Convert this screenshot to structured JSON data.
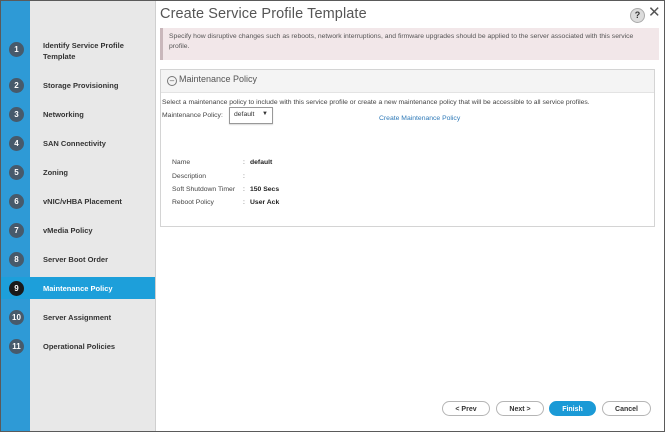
{
  "title": "Create Service Profile Template",
  "banner_text": "Specify how disruptive changes such as reboots, network interruptions, and firmware upgrades should be applied to the server associated with this service profile.",
  "steps": [
    {
      "num": "1",
      "label": "Identify Service Profile Template"
    },
    {
      "num": "2",
      "label": "Storage Provisioning"
    },
    {
      "num": "3",
      "label": "Networking"
    },
    {
      "num": "4",
      "label": "SAN Connectivity"
    },
    {
      "num": "5",
      "label": "Zoning"
    },
    {
      "num": "6",
      "label": "vNIC/vHBA Placement"
    },
    {
      "num": "7",
      "label": "vMedia Policy"
    },
    {
      "num": "8",
      "label": "Server Boot Order"
    },
    {
      "num": "9",
      "label": "Maintenance Policy"
    },
    {
      "num": "10",
      "label": "Server Assignment"
    },
    {
      "num": "11",
      "label": "Operational Policies"
    }
  ],
  "active_step": "9",
  "panel": {
    "title": "Maintenance Policy",
    "description": "Select a maintenance policy to include with this service profile or create a new maintenance policy that will be accessible to all service profiles.",
    "select_label": "Maintenance Policy:",
    "select_value": "default",
    "create_link": "Create Maintenance Policy",
    "details": [
      {
        "key": "Name",
        "value": "default"
      },
      {
        "key": "Description",
        "value": ""
      },
      {
        "key": "Soft Shutdown Timer",
        "value": "150 Secs"
      },
      {
        "key": "Reboot Policy",
        "value": "User Ack"
      }
    ]
  },
  "buttons": {
    "prev": "< Prev",
    "next": "Next >",
    "finish": "Finish",
    "cancel": "Cancel"
  },
  "colors": {
    "accent": "#1d9fda",
    "rail": "#2e9ad6",
    "banner": "#f2e7e9"
  }
}
